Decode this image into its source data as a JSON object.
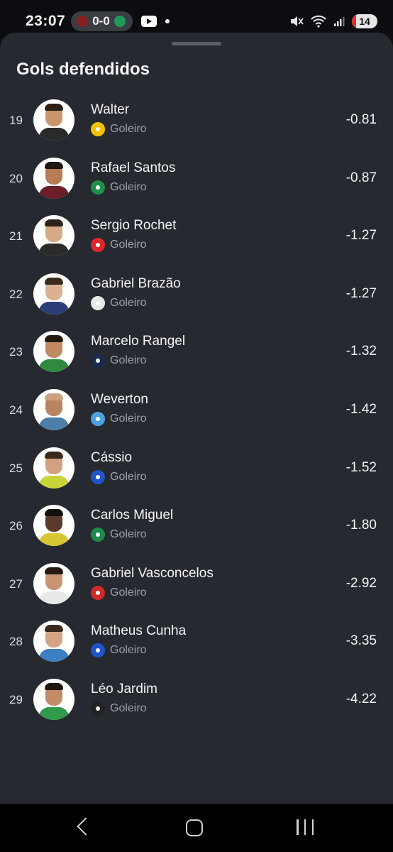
{
  "status_bar": {
    "time": "23:07",
    "live_score": "0-0",
    "battery": "14",
    "home_team_color": "#8a1f1f",
    "away_team_color": "#1f9a5c"
  },
  "sheet": {
    "title": "Gols defendidos"
  },
  "players": [
    {
      "rank": "19",
      "name": "Walter",
      "position": "Goleiro",
      "value": "-0.81",
      "club_color": "#f2c200",
      "skin": "#c9956d",
      "hair": "#2b2119",
      "shirt": "#2a2a2a"
    },
    {
      "rank": "20",
      "name": "Rafael Santos",
      "position": "Goleiro",
      "value": "-0.87",
      "club_color": "#1f8f4a",
      "skin": "#b57c55",
      "hair": "#1f1712",
      "shirt": "#6a1f2b"
    },
    {
      "rank": "21",
      "name": "Sergio Rochet",
      "position": "Goleiro",
      "value": "-1.27",
      "club_color": "#e0262b",
      "skin": "#d8a987",
      "hair": "#2d2219",
      "shirt": "#2b2b2b"
    },
    {
      "rank": "22",
      "name": "Gabriel Brazão",
      "position": "Goleiro",
      "value": "-1.27",
      "club_color": "#e8e8e8",
      "skin": "#dcb094",
      "hair": "#3a2b1d",
      "shirt": "#2c3e78"
    },
    {
      "rank": "23",
      "name": "Marcelo Rangel",
      "position": "Goleiro",
      "value": "-1.32",
      "club_color": "#1b2a4a",
      "skin": "#c08a63",
      "hair": "#231a12",
      "shirt": "#2f8a3e"
    },
    {
      "rank": "24",
      "name": "Weverton",
      "position": "Goleiro",
      "value": "-1.42",
      "club_color": "#4aa3df",
      "skin": "#b88462",
      "hair": "#c9a27f",
      "shirt": "#4d7ea8"
    },
    {
      "rank": "25",
      "name": "Cássio",
      "position": "Goleiro",
      "value": "-1.52",
      "club_color": "#1e55c8",
      "skin": "#d2a181",
      "hair": "#3b2a1c",
      "shirt": "#c8d43a"
    },
    {
      "rank": "26",
      "name": "Carlos Miguel",
      "position": "Goleiro",
      "value": "-1.80",
      "club_color": "#1f8a4c",
      "skin": "#5a3a28",
      "hair": "#141010",
      "shirt": "#d8c534"
    },
    {
      "rank": "27",
      "name": "Gabriel Vasconcelos",
      "position": "Goleiro",
      "value": "-2.92",
      "club_color": "#d12a2a",
      "skin": "#c99472",
      "hair": "#241a12",
      "shirt": "#e9e9e9"
    },
    {
      "rank": "28",
      "name": "Matheus Cunha",
      "position": "Goleiro",
      "value": "-3.35",
      "club_color": "#1e55c8",
      "skin": "#d4a584",
      "hair": "#3a2a1d",
      "shirt": "#3d7fc0"
    },
    {
      "rank": "29",
      "name": "Léo Jardim",
      "position": "Goleiro",
      "value": "-4.22",
      "club_color": "#222222",
      "skin": "#c38c68",
      "hair": "#20160f",
      "shirt": "#2f9a4a"
    }
  ]
}
